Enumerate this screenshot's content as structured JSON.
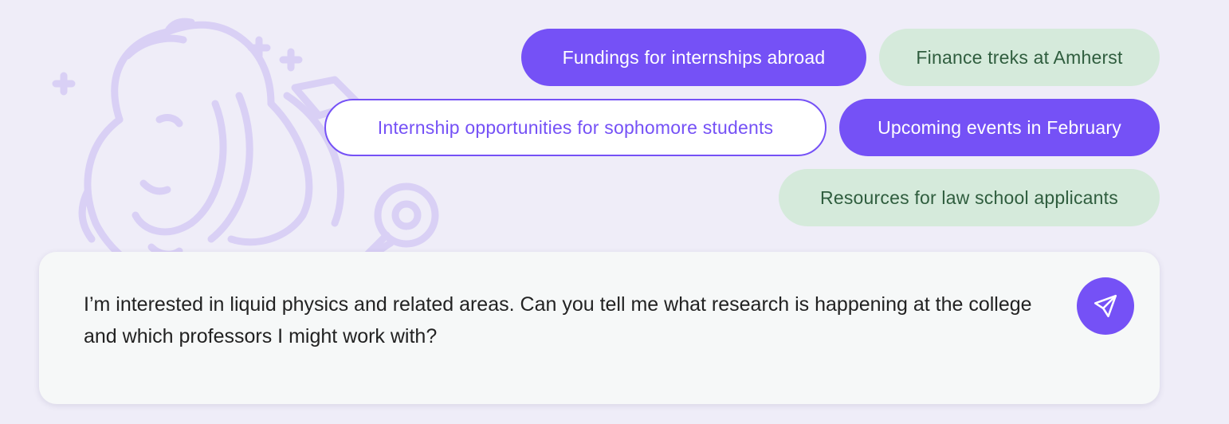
{
  "suggestions": {
    "fundings_abroad": "Fundings for internships abroad",
    "finance_treks": "Finance treks at Amherst",
    "sophomore_internships": "Internship opportunities for sophomore students",
    "february_events": "Upcoming events in February",
    "law_school_resources": "Resources for law school applicants"
  },
  "composer": {
    "message": "I’m interested in liquid physics and related areas. Can you tell me what research is happening at the college and which professors I might work with?"
  },
  "icons": {
    "mascot": "mammoth-mascot-icon",
    "send": "paper-plane-icon"
  },
  "colors": {
    "accent": "#7551f6",
    "mint": "#d5eadb",
    "mint_text": "#2f5d3e",
    "background": "#efedf8"
  }
}
